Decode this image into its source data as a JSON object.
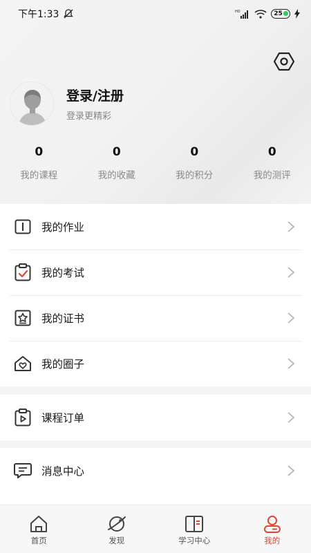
{
  "status_bar": {
    "time": "下午1:33",
    "network": "HD",
    "battery": "25"
  },
  "profile": {
    "title": "登录/注册",
    "subtitle": "登录更精彩"
  },
  "stats": [
    {
      "value": "0",
      "label": "我的课程"
    },
    {
      "value": "0",
      "label": "我的收藏"
    },
    {
      "value": "0",
      "label": "我的积分"
    },
    {
      "value": "0",
      "label": "我的测评"
    }
  ],
  "menu": {
    "group1": [
      {
        "label": "我的作业",
        "icon": "homework-book-icon"
      },
      {
        "label": "我的考试",
        "icon": "exam-clipboard-icon"
      },
      {
        "label": "我的证书",
        "icon": "certificate-star-icon"
      },
      {
        "label": "我的圈子",
        "icon": "circle-heart-house-icon"
      }
    ],
    "group2": [
      {
        "label": "课程订单",
        "icon": "order-play-icon"
      }
    ],
    "group3": [
      {
        "label": "消息中心",
        "icon": "message-bubble-icon"
      }
    ]
  },
  "tabbar": [
    {
      "label": "首页",
      "icon": "home-icon"
    },
    {
      "label": "发现",
      "icon": "planet-icon"
    },
    {
      "label": "学习中心",
      "icon": "book-icon"
    },
    {
      "label": "我的",
      "icon": "person-icon",
      "active": true
    }
  ],
  "colors": {
    "accent": "#e2452f",
    "icon_dark": "#333333"
  }
}
